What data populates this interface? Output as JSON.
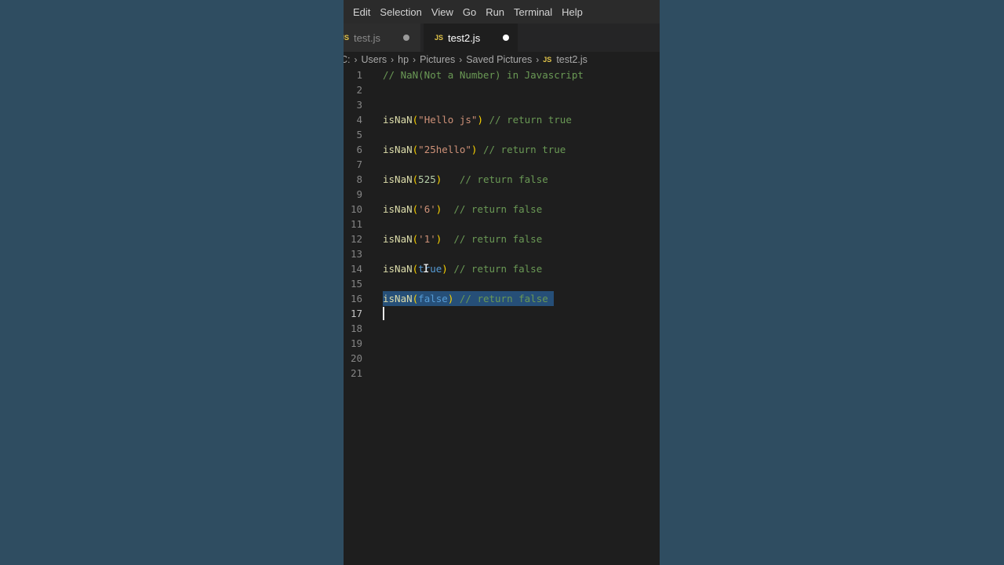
{
  "menu": [
    "Edit",
    "Selection",
    "View",
    "Go",
    "Run",
    "Terminal",
    "Help"
  ],
  "tabs": {
    "inactive": {
      "badge": "JS",
      "label": "test.js"
    },
    "active": {
      "badge": "JS",
      "label": "test2.js"
    }
  },
  "breadcrumb": {
    "root": "C:",
    "parts": [
      "Users",
      "hp",
      "Pictures",
      "Saved Pictures"
    ],
    "file_badge": "JS",
    "file": "test2.js"
  },
  "editor": {
    "line_numbers": [
      "1",
      "2",
      "3",
      "4",
      "5",
      "6",
      "7",
      "8",
      "9",
      "10",
      "11",
      "12",
      "13",
      "14",
      "15",
      "16",
      "17",
      "18",
      "19",
      "20",
      "21"
    ],
    "current_line": "17",
    "lines": [
      {
        "n": "1",
        "tokens": [
          {
            "t": "cm",
            "v": "// NaN(Not a Number) in Javascript"
          }
        ]
      },
      {
        "n": "4",
        "tokens": [
          {
            "t": "fn",
            "v": "isNaN"
          },
          {
            "t": "paren",
            "v": "("
          },
          {
            "t": "str",
            "v": "\"Hello js\""
          },
          {
            "t": "paren",
            "v": ")"
          },
          {
            "t": "plain",
            "v": " "
          },
          {
            "t": "cm",
            "v": "// return true"
          }
        ]
      },
      {
        "n": "6",
        "tokens": [
          {
            "t": "fn",
            "v": "isNaN"
          },
          {
            "t": "paren",
            "v": "("
          },
          {
            "t": "str",
            "v": "\"25hello\""
          },
          {
            "t": "paren",
            "v": ")"
          },
          {
            "t": "plain",
            "v": " "
          },
          {
            "t": "cm",
            "v": "// return true"
          }
        ]
      },
      {
        "n": "8",
        "tokens": [
          {
            "t": "fn",
            "v": "isNaN"
          },
          {
            "t": "paren",
            "v": "("
          },
          {
            "t": "num",
            "v": "525"
          },
          {
            "t": "paren",
            "v": ")"
          },
          {
            "t": "plain",
            "v": "   "
          },
          {
            "t": "cm",
            "v": "// return false"
          }
        ]
      },
      {
        "n": "10",
        "tokens": [
          {
            "t": "fn",
            "v": "isNaN"
          },
          {
            "t": "paren",
            "v": "("
          },
          {
            "t": "str",
            "v": "'6'"
          },
          {
            "t": "paren",
            "v": ")"
          },
          {
            "t": "plain",
            "v": "  "
          },
          {
            "t": "cm",
            "v": "// return false"
          }
        ]
      },
      {
        "n": "12",
        "tokens": [
          {
            "t": "fn",
            "v": "isNaN"
          },
          {
            "t": "paren",
            "v": "("
          },
          {
            "t": "str",
            "v": "'1'"
          },
          {
            "t": "paren",
            "v": ")"
          },
          {
            "t": "plain",
            "v": "  "
          },
          {
            "t": "cm",
            "v": "// return false"
          }
        ]
      },
      {
        "n": "14",
        "tokens": [
          {
            "t": "fn",
            "v": "isNaN"
          },
          {
            "t": "paren",
            "v": "("
          },
          {
            "t": "kw",
            "v": "true"
          },
          {
            "t": "paren",
            "v": ")"
          },
          {
            "t": "plain",
            "v": " "
          },
          {
            "t": "cm",
            "v": "// return false"
          }
        ]
      },
      {
        "n": "16",
        "selected": true,
        "tokens": [
          {
            "t": "fn",
            "v": "isNaN"
          },
          {
            "t": "paren",
            "v": "("
          },
          {
            "t": "kw",
            "v": "false"
          },
          {
            "t": "paren",
            "v": ")"
          },
          {
            "t": "plain",
            "v": " "
          },
          {
            "t": "cm",
            "v": "// return false"
          }
        ]
      }
    ]
  },
  "colors": {
    "editor_bg": "#1e1e1e",
    "selection": "#264f78",
    "function": "#dcdcaa",
    "string": "#ce9178",
    "number": "#b5cea8",
    "keyword": "#569cd6",
    "comment": "#6a9955",
    "bracket": "#ffd700",
    "js_badge": "#e2c54a"
  }
}
